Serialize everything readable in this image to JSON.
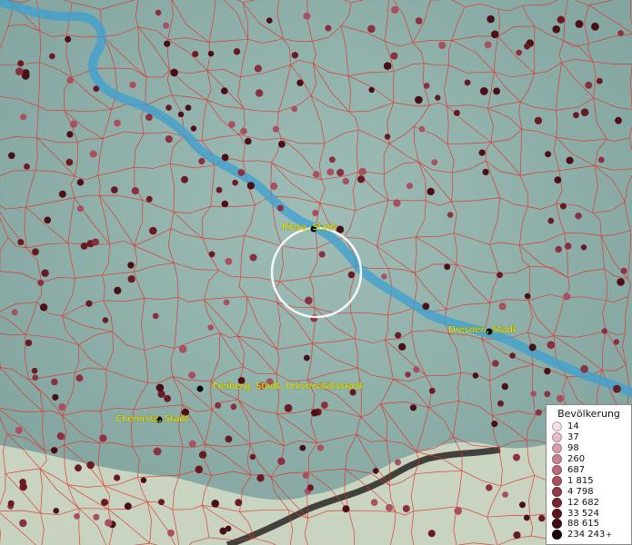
{
  "map": {
    "background_color": "#86aaa4",
    "mountain_color": "#e8ecd8",
    "river_color": "#3ca0d0",
    "border_color": "#e0332a",
    "dot_colors": [
      "#4a0f17",
      "#6a1a24",
      "#8a3040",
      "#a85060"
    ],
    "city_label_color": "#f4f000",
    "cities": [
      {
        "name": "Riesa, Stadt",
        "icon": "city-marker-icon"
      },
      {
        "name": "Dresden, Stadt",
        "icon": "city-marker-icon"
      },
      {
        "name": "Freiberg, Stadt, Universitätsstadt",
        "icon": "city-marker-icon"
      },
      {
        "name": "Chemnitz, Stadt",
        "icon": "city-marker-icon"
      }
    ]
  },
  "legend": {
    "title": "Bevölkerung",
    "more_mark": "+",
    "items": [
      {
        "label": "14",
        "color": "#f6dde6"
      },
      {
        "label": "37",
        "color": "#e8bccb"
      },
      {
        "label": "98",
        "color": "#d89fae"
      },
      {
        "label": "260",
        "color": "#c98392"
      },
      {
        "label": "687",
        "color": "#b86a78"
      },
      {
        "label": "1 815",
        "color": "#a5525f"
      },
      {
        "label": "4 798",
        "color": "#8f3b48"
      },
      {
        "label": "12 682",
        "color": "#772633"
      },
      {
        "label": "33 524",
        "color": "#5c1622"
      },
      {
        "label": "88 615",
        "color": "#400c16"
      },
      {
        "label": "234 243",
        "color": "#1f030a"
      }
    ]
  }
}
